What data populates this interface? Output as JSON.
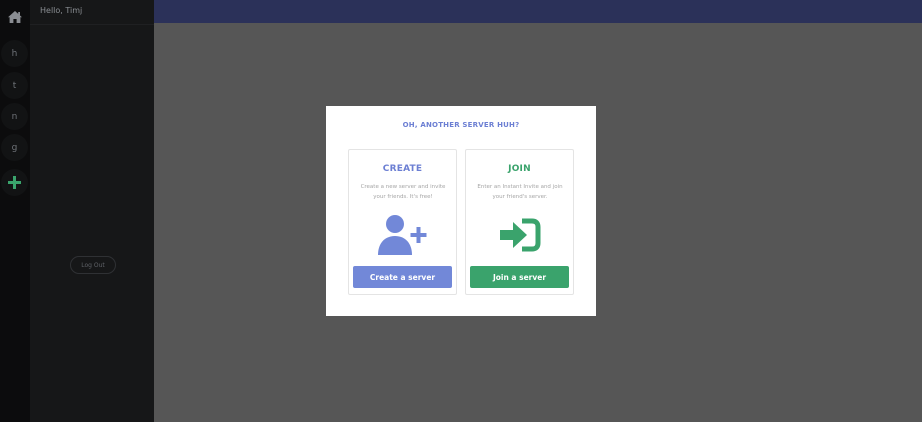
{
  "rail": {
    "servers": [
      "h",
      "t",
      "n",
      "g"
    ]
  },
  "sidebar": {
    "greeting": "Hello, Timj",
    "logout_label": "Log Out"
  },
  "modal": {
    "title": "OH, ANOTHER SERVER HUH?",
    "create": {
      "title": "CREATE",
      "description": "Create a new server and invite your friends. It's free!",
      "button_label": "Create a server",
      "color": "#7288d8"
    },
    "join": {
      "title": "JOIN",
      "description": "Enter an Instant Invite and join your friend's server.",
      "button_label": "Join a server",
      "color": "#3aa36c"
    }
  },
  "colors": {
    "header": "#2b3159",
    "overlay": "#565656",
    "accent_blue": "#6c7fd3",
    "accent_green": "#3aa36c"
  },
  "icons": {
    "home": "home-icon",
    "add": "plus-icon",
    "create": "add-user-icon",
    "join": "sign-in-icon"
  }
}
